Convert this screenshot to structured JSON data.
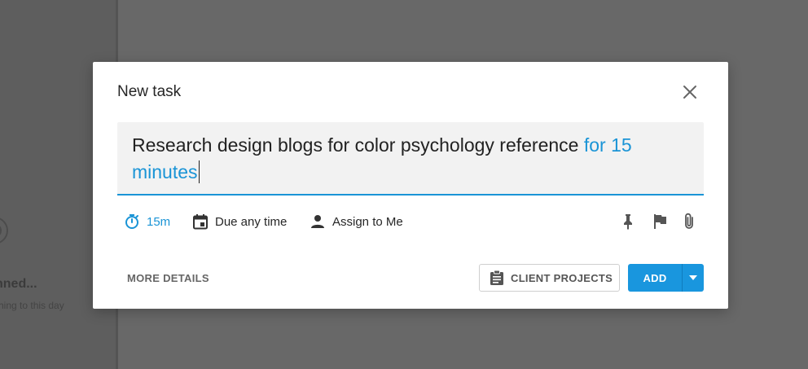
{
  "background": {
    "title": "nned...",
    "subtitle": "hing to this day"
  },
  "modal": {
    "title": "New task",
    "input": {
      "text": "Research design blogs for color psychology reference",
      "highlight": "for 15 minutes"
    },
    "meta": {
      "duration": "15m",
      "due": "Due any time",
      "assign": "Assign to Me"
    },
    "footer": {
      "more_details": "MORE DETAILS",
      "client_projects": "CLIENT PROJECTS",
      "add": "ADD"
    }
  },
  "colors": {
    "accent": "#1a94d6",
    "button": "#1996de",
    "overlay": "#6a6a6a"
  },
  "icons": [
    "close-icon",
    "timer-icon",
    "calendar-icon",
    "person-icon",
    "pin-icon",
    "flag-icon",
    "paperclip-icon",
    "clipboard-icon",
    "caret-down-icon"
  ]
}
